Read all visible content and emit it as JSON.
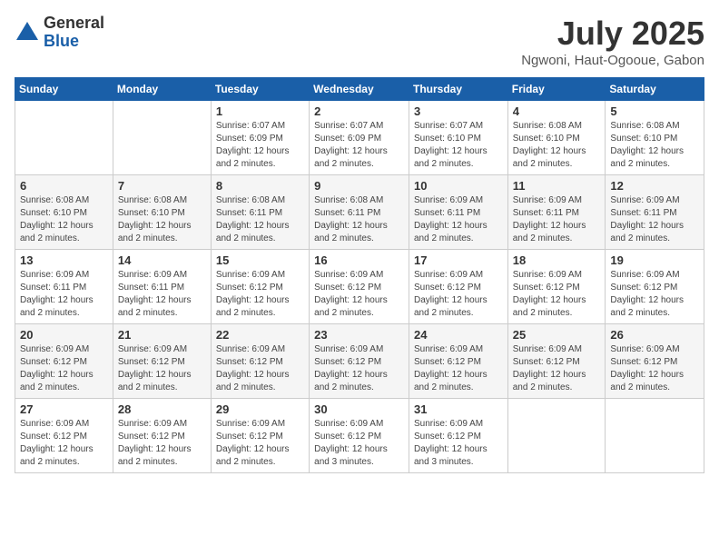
{
  "header": {
    "logo_general": "General",
    "logo_blue": "Blue",
    "month": "July 2025",
    "location": "Ngwoni, Haut-Ogooue, Gabon"
  },
  "weekdays": [
    "Sunday",
    "Monday",
    "Tuesday",
    "Wednesday",
    "Thursday",
    "Friday",
    "Saturday"
  ],
  "weeks": [
    [
      {
        "day": "",
        "info": ""
      },
      {
        "day": "",
        "info": ""
      },
      {
        "day": "1",
        "info": "Sunrise: 6:07 AM\nSunset: 6:09 PM\nDaylight: 12 hours and 2 minutes."
      },
      {
        "day": "2",
        "info": "Sunrise: 6:07 AM\nSunset: 6:09 PM\nDaylight: 12 hours and 2 minutes."
      },
      {
        "day": "3",
        "info": "Sunrise: 6:07 AM\nSunset: 6:10 PM\nDaylight: 12 hours and 2 minutes."
      },
      {
        "day": "4",
        "info": "Sunrise: 6:08 AM\nSunset: 6:10 PM\nDaylight: 12 hours and 2 minutes."
      },
      {
        "day": "5",
        "info": "Sunrise: 6:08 AM\nSunset: 6:10 PM\nDaylight: 12 hours and 2 minutes."
      }
    ],
    [
      {
        "day": "6",
        "info": "Sunrise: 6:08 AM\nSunset: 6:10 PM\nDaylight: 12 hours and 2 minutes."
      },
      {
        "day": "7",
        "info": "Sunrise: 6:08 AM\nSunset: 6:10 PM\nDaylight: 12 hours and 2 minutes."
      },
      {
        "day": "8",
        "info": "Sunrise: 6:08 AM\nSunset: 6:11 PM\nDaylight: 12 hours and 2 minutes."
      },
      {
        "day": "9",
        "info": "Sunrise: 6:08 AM\nSunset: 6:11 PM\nDaylight: 12 hours and 2 minutes."
      },
      {
        "day": "10",
        "info": "Sunrise: 6:09 AM\nSunset: 6:11 PM\nDaylight: 12 hours and 2 minutes."
      },
      {
        "day": "11",
        "info": "Sunrise: 6:09 AM\nSunset: 6:11 PM\nDaylight: 12 hours and 2 minutes."
      },
      {
        "day": "12",
        "info": "Sunrise: 6:09 AM\nSunset: 6:11 PM\nDaylight: 12 hours and 2 minutes."
      }
    ],
    [
      {
        "day": "13",
        "info": "Sunrise: 6:09 AM\nSunset: 6:11 PM\nDaylight: 12 hours and 2 minutes."
      },
      {
        "day": "14",
        "info": "Sunrise: 6:09 AM\nSunset: 6:11 PM\nDaylight: 12 hours and 2 minutes."
      },
      {
        "day": "15",
        "info": "Sunrise: 6:09 AM\nSunset: 6:12 PM\nDaylight: 12 hours and 2 minutes."
      },
      {
        "day": "16",
        "info": "Sunrise: 6:09 AM\nSunset: 6:12 PM\nDaylight: 12 hours and 2 minutes."
      },
      {
        "day": "17",
        "info": "Sunrise: 6:09 AM\nSunset: 6:12 PM\nDaylight: 12 hours and 2 minutes."
      },
      {
        "day": "18",
        "info": "Sunrise: 6:09 AM\nSunset: 6:12 PM\nDaylight: 12 hours and 2 minutes."
      },
      {
        "day": "19",
        "info": "Sunrise: 6:09 AM\nSunset: 6:12 PM\nDaylight: 12 hours and 2 minutes."
      }
    ],
    [
      {
        "day": "20",
        "info": "Sunrise: 6:09 AM\nSunset: 6:12 PM\nDaylight: 12 hours and 2 minutes."
      },
      {
        "day": "21",
        "info": "Sunrise: 6:09 AM\nSunset: 6:12 PM\nDaylight: 12 hours and 2 minutes."
      },
      {
        "day": "22",
        "info": "Sunrise: 6:09 AM\nSunset: 6:12 PM\nDaylight: 12 hours and 2 minutes."
      },
      {
        "day": "23",
        "info": "Sunrise: 6:09 AM\nSunset: 6:12 PM\nDaylight: 12 hours and 2 minutes."
      },
      {
        "day": "24",
        "info": "Sunrise: 6:09 AM\nSunset: 6:12 PM\nDaylight: 12 hours and 2 minutes."
      },
      {
        "day": "25",
        "info": "Sunrise: 6:09 AM\nSunset: 6:12 PM\nDaylight: 12 hours and 2 minutes."
      },
      {
        "day": "26",
        "info": "Sunrise: 6:09 AM\nSunset: 6:12 PM\nDaylight: 12 hours and 2 minutes."
      }
    ],
    [
      {
        "day": "27",
        "info": "Sunrise: 6:09 AM\nSunset: 6:12 PM\nDaylight: 12 hours and 2 minutes."
      },
      {
        "day": "28",
        "info": "Sunrise: 6:09 AM\nSunset: 6:12 PM\nDaylight: 12 hours and 2 minutes."
      },
      {
        "day": "29",
        "info": "Sunrise: 6:09 AM\nSunset: 6:12 PM\nDaylight: 12 hours and 2 minutes."
      },
      {
        "day": "30",
        "info": "Sunrise: 6:09 AM\nSunset: 6:12 PM\nDaylight: 12 hours and 3 minutes."
      },
      {
        "day": "31",
        "info": "Sunrise: 6:09 AM\nSunset: 6:12 PM\nDaylight: 12 hours and 3 minutes."
      },
      {
        "day": "",
        "info": ""
      },
      {
        "day": "",
        "info": ""
      }
    ]
  ]
}
